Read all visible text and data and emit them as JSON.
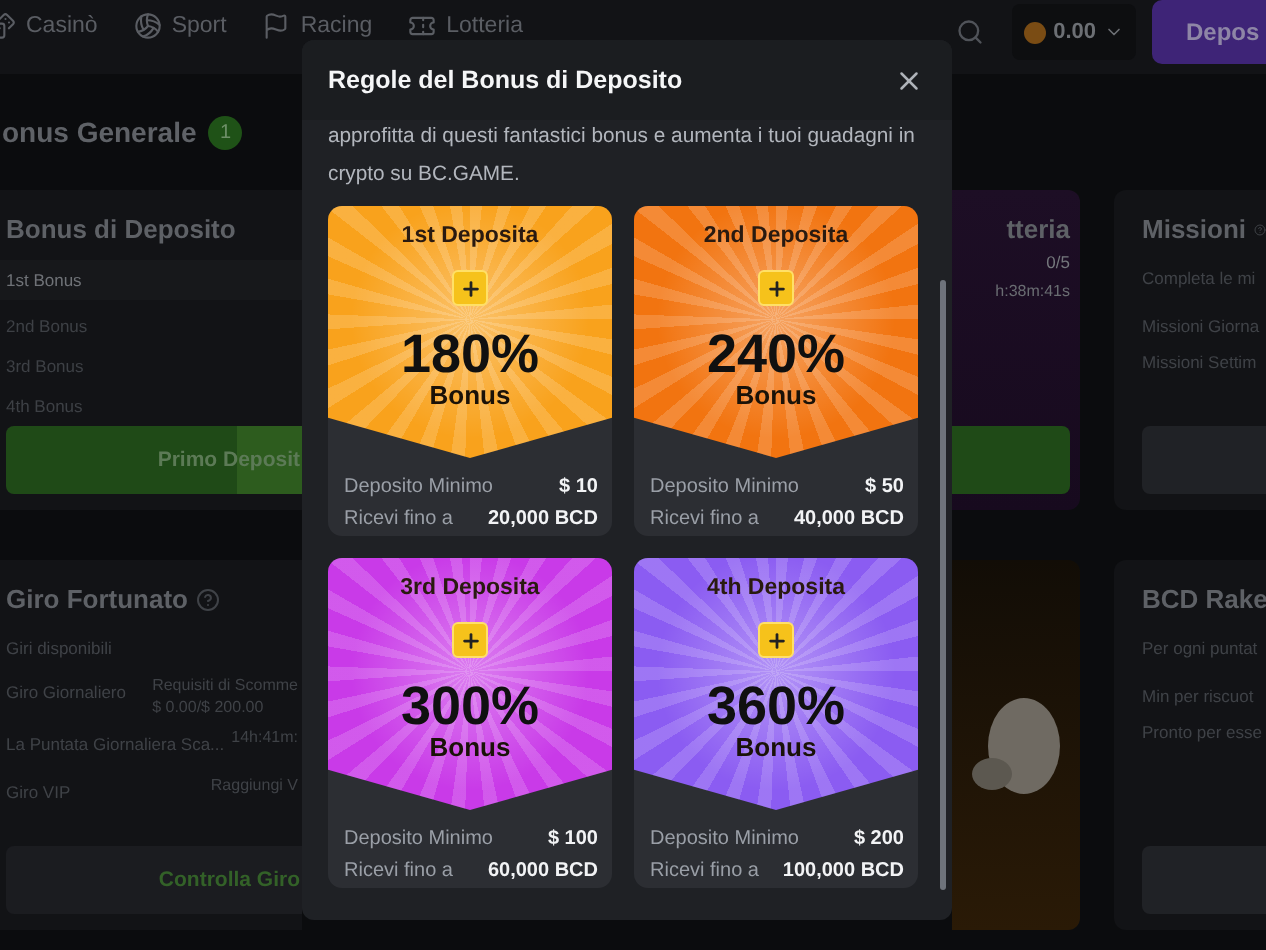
{
  "nav": {
    "items": [
      {
        "label": "Casinò",
        "kind": "dice"
      },
      {
        "label": "Sport",
        "kind": "ball"
      },
      {
        "label": "Racing",
        "kind": "flag"
      },
      {
        "label": "Lotteria",
        "kind": "ticket"
      }
    ],
    "balance": "0.00",
    "deposit_button": "Depos"
  },
  "section": {
    "title": "onus Generale",
    "badge": "1"
  },
  "deposit_card": {
    "title": "Bonus di Deposito",
    "tiers": [
      {
        "label": "1st Bonus",
        "selected": true
      },
      {
        "label": "2nd Bonus",
        "selected": false
      },
      {
        "label": "3rd Bonus",
        "selected": false
      },
      {
        "label": "4th Bonus",
        "selected": false
      }
    ],
    "button": "Primo Deposit"
  },
  "lottery_card": {
    "title": "tteria",
    "count": "0/5",
    "timer": "h:38m:41s"
  },
  "missions_card": {
    "title": "Missioni",
    "subtitle": "Completa le mi",
    "rows": [
      "Missioni Giorna",
      "Missioni Settim"
    ]
  },
  "spin_card": {
    "title": "Giro Fortunato",
    "subtitle": "Giri disponibili",
    "rows": [
      {
        "label": "Giro Giornaliero",
        "value": "Requisiti di Scomme",
        "sub": "$ 0.00/$ 200.00"
      },
      {
        "label": "La Puntata Giornaliera Sca...",
        "value": "14h:41m:"
      },
      {
        "label": "Giro VIP",
        "value": "Raggiungi V"
      }
    ],
    "button": "Controlla Giro"
  },
  "rake_card": {
    "title": "BCD Rake",
    "subtitle": "Per ogni puntat",
    "rows": [
      "Min per riscuot",
      "Pronto per esse"
    ]
  },
  "modal": {
    "title": "Regole del Bonus di Deposito",
    "intro": "approfitta di questi fantastici bonus e aumenta i tuoi guadagni in crypto su BC.GAME.",
    "tiers": [
      {
        "title": "1st Deposita",
        "percent": "180%",
        "bonus": "Bonus",
        "color": "#f9a21c",
        "min_label": "Deposito Minimo",
        "min_value": "$ 10",
        "receive_label": "Ricevi fino a",
        "receive_value": "20,000 BCD"
      },
      {
        "title": "2nd Deposita",
        "percent": "240%",
        "bonus": "Bonus",
        "color": "#f27410",
        "min_label": "Deposito Minimo",
        "min_value": "$ 50",
        "receive_label": "Ricevi fino a",
        "receive_value": "40,000 BCD"
      },
      {
        "title": "3rd Deposita",
        "percent": "300%",
        "bonus": "Bonus",
        "color": "#c93ae8",
        "min_label": "Deposito Minimo",
        "min_value": "$ 100",
        "receive_label": "Ricevi fino a",
        "receive_value": "60,000 BCD"
      },
      {
        "title": "4th Deposita",
        "percent": "360%",
        "bonus": "Bonus",
        "color": "#8b5cf2",
        "min_label": "Deposito Minimo",
        "min_value": "$ 200",
        "receive_label": "Ricevi fino a",
        "receive_value": "100,000 BCD"
      }
    ]
  }
}
